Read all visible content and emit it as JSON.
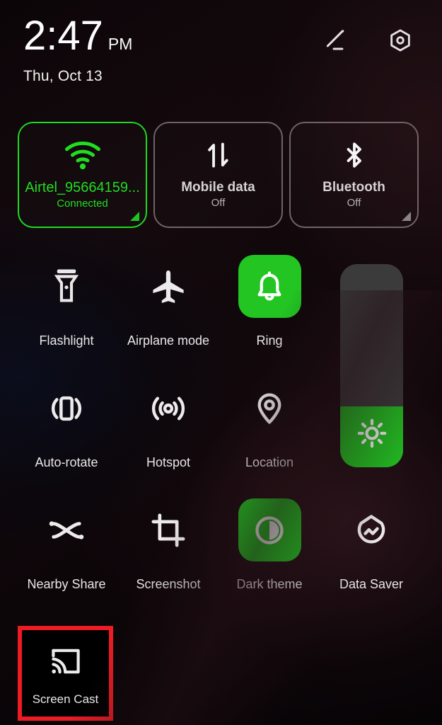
{
  "status_bar": {
    "time": "2:47",
    "am_pm": "PM",
    "date": "Thu, Oct 13",
    "edit_icon": "pencil-edit-icon",
    "settings_icon": "settings-gear-icon"
  },
  "colors": {
    "accent_green": "#22c522",
    "active_border": "#1fd81f",
    "inactive_border": "#6f6366",
    "highlight_red": "#ed1c24",
    "slider_track": "#3b3b3b",
    "background": "#0a0406"
  },
  "connectivity_tiles": [
    {
      "id": "wifi",
      "icon": "wifi-icon",
      "label": "Airtel_95664159...",
      "sub": "Connected",
      "active": true,
      "has_expand_corner": true
    },
    {
      "id": "mobile-data",
      "icon": "mobile-data-icon",
      "label": "Mobile data",
      "sub": "Off",
      "active": false,
      "has_expand_corner": false
    },
    {
      "id": "bluetooth",
      "icon": "bluetooth-icon",
      "label": "Bluetooth",
      "sub": "Off",
      "active": false,
      "has_expand_corner": true
    }
  ],
  "quick_tiles": [
    {
      "id": "flashlight",
      "label": "Flashlight",
      "icon": "flashlight-icon",
      "active": false
    },
    {
      "id": "airplane-mode",
      "label": "Airplane mode",
      "icon": "airplane-icon",
      "active": false
    },
    {
      "id": "ring",
      "label": "Ring",
      "icon": "bell-icon",
      "active": true
    },
    {
      "id": "auto-rotate",
      "label": "Auto-rotate",
      "icon": "auto-rotate-icon",
      "active": false
    },
    {
      "id": "hotspot",
      "label": "Hotspot",
      "icon": "hotspot-icon",
      "active": false
    },
    {
      "id": "location",
      "label": "Location",
      "icon": "location-pin-icon",
      "active": false
    },
    {
      "id": "nearby-share",
      "label": "Nearby Share",
      "icon": "nearby-share-icon",
      "active": false
    },
    {
      "id": "screenshot",
      "label": "Screenshot",
      "icon": "screenshot-crop-icon",
      "active": false
    },
    {
      "id": "dark-theme",
      "label": "Dark theme",
      "icon": "dark-theme-icon",
      "active": true
    },
    {
      "id": "data-saver",
      "label": "Data Saver",
      "icon": "data-saver-icon",
      "active": false
    },
    {
      "id": "screen-cast",
      "label": "Screen Cast",
      "icon": "screen-cast-icon",
      "active": false
    }
  ],
  "brightness_slider": {
    "label": "Brightness",
    "icon": "brightness-sun-icon",
    "level_percent": 30
  },
  "annotation": {
    "target": "Screen Cast",
    "shape": "red-rectangle-highlight"
  }
}
